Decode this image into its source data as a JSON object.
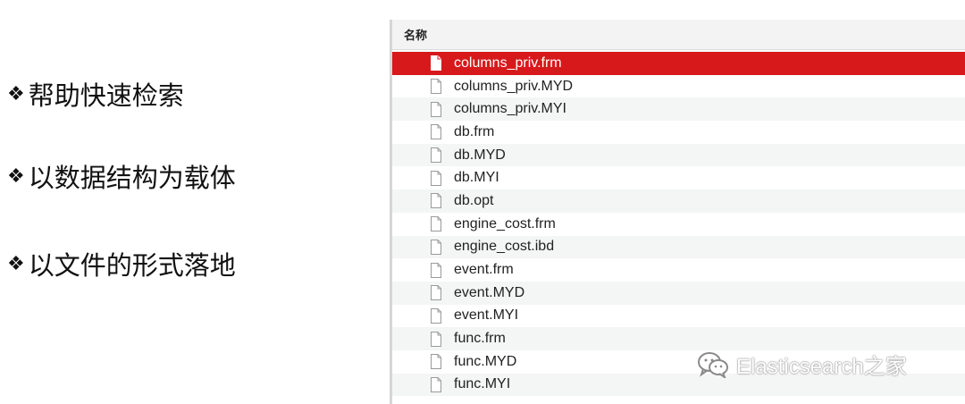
{
  "bullets": {
    "marker": "❖",
    "items": [
      "帮助快速检索",
      "以数据结构为载体",
      "以文件的形式落地"
    ]
  },
  "finder": {
    "column_header": "名称",
    "selected_index": 0,
    "files": [
      "columns_priv.frm",
      "columns_priv.MYD",
      "columns_priv.MYI",
      "db.frm",
      "db.MYD",
      "db.MYI",
      "db.opt",
      "engine_cost.frm",
      "engine_cost.ibd",
      "event.frm",
      "event.MYD",
      "event.MYI",
      "func.frm",
      "func.MYD",
      "func.MYI"
    ],
    "selection_color": "#d7191c"
  },
  "watermark": {
    "text": "Elasticsearch之家",
    "icon": "wechat-icon"
  }
}
